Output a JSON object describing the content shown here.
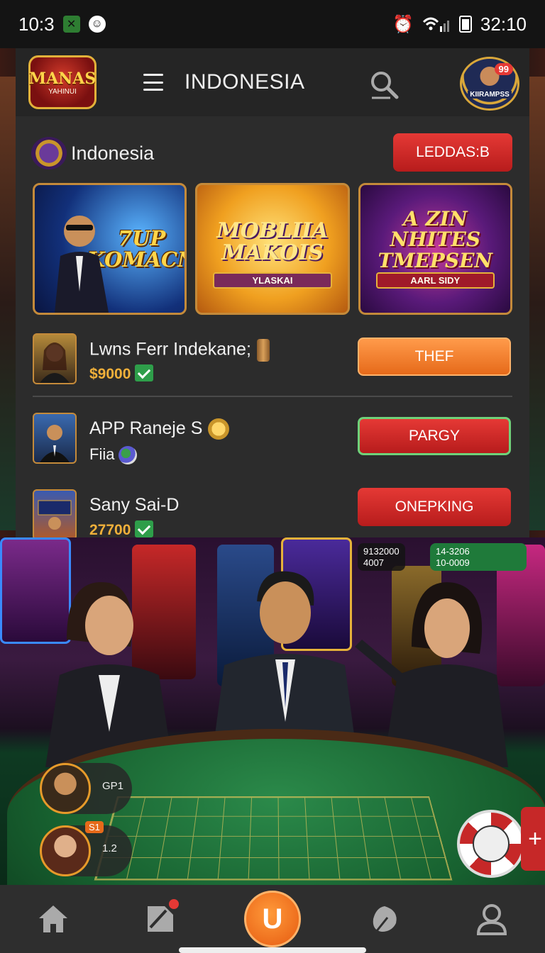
{
  "status_bar": {
    "time": "10:3",
    "clock": "32:10"
  },
  "header": {
    "logo_text": "MANAS",
    "logo_sub": "YAHINUI",
    "title": "INDONESIA",
    "avatar_text": "KIIRAMPSS",
    "notification_count": "99"
  },
  "section": {
    "title": "Indonesia",
    "action_label": "LEDDAS:B"
  },
  "banners": [
    {
      "text": "7UP\nKOMACN"
    },
    {
      "text": "MOBLIIA\nMAKOIS",
      "sub": "YLASKAI"
    },
    {
      "text": "A ZIN NHITES\nTMEPSEN",
      "sub": "AARL SIDY"
    }
  ],
  "list": [
    {
      "title": "Lwns Ferr Indekane;",
      "amount": "$9000",
      "button": "THEF"
    },
    {
      "title": "APP Raneje S",
      "sub": "Fiia",
      "button": "PARGY"
    },
    {
      "title": "Sany Sai-D",
      "amount": "27700",
      "button": "ONEPKING"
    }
  ],
  "scene": {
    "overlay_left_line1": "9132000",
    "overlay_left_line2": "4007",
    "overlay_right_line1": "14-3206",
    "overlay_right_line2": "10-0009",
    "player1_label": "GP1",
    "player2_label": "1.2",
    "player2_badge": "S1"
  },
  "bottom_nav": {
    "center_glyph": "U"
  },
  "colors": {
    "accent_red": "#d32f2f",
    "accent_orange": "#f07a2a",
    "gold": "#f0b03a",
    "panel": "#2c2c2c"
  },
  "icons": [
    "home-icon",
    "tag-icon",
    "leaf-icon",
    "user-icon",
    "search-icon",
    "menu-icon"
  ]
}
